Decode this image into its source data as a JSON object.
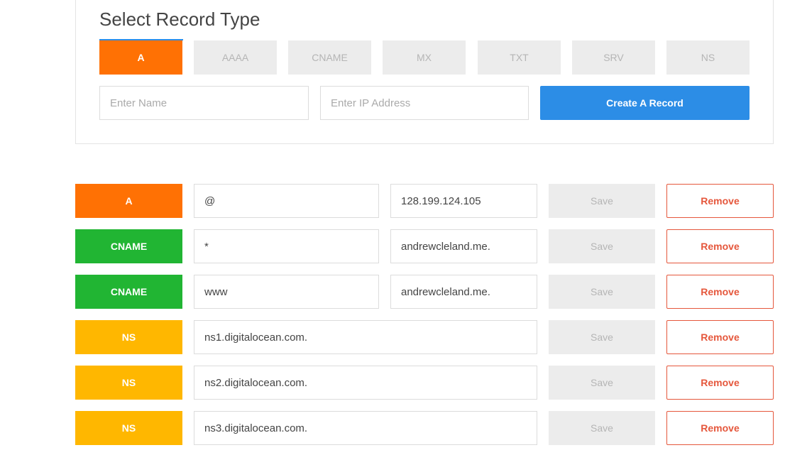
{
  "section": {
    "title": "Select Record Type"
  },
  "type_tabs": [
    {
      "label": "A",
      "active": true
    },
    {
      "label": "AAAA",
      "active": false
    },
    {
      "label": "CNAME",
      "active": false
    },
    {
      "label": "MX",
      "active": false
    },
    {
      "label": "TXT",
      "active": false
    },
    {
      "label": "SRV",
      "active": false
    },
    {
      "label": "NS",
      "active": false
    }
  ],
  "form": {
    "name_placeholder": "Enter Name",
    "name_value": "",
    "ip_placeholder": "Enter IP Address",
    "ip_value": "",
    "create_label": "Create A Record"
  },
  "records": [
    {
      "type": "A",
      "color": "#ff7104",
      "name": "@",
      "value": "128.199.124.105"
    },
    {
      "type": "CNAME",
      "color": "#21b533",
      "name": "*",
      "value": "andrewcleland.me."
    },
    {
      "type": "CNAME",
      "color": "#21b533",
      "name": "www",
      "value": "andrewcleland.me."
    },
    {
      "type": "NS",
      "color": "#ffb700",
      "name": "ns1.digitalocean.com.",
      "value": null
    },
    {
      "type": "NS",
      "color": "#ffb700",
      "name": "ns2.digitalocean.com.",
      "value": null
    },
    {
      "type": "NS",
      "color": "#ffb700",
      "name": "ns3.digitalocean.com.",
      "value": null
    }
  ],
  "labels": {
    "save": "Save",
    "remove": "Remove"
  },
  "colors": {
    "accent_blue": "#2c8de6",
    "type_a": "#ff7104",
    "type_cname": "#21b533",
    "type_ns": "#ffb700",
    "danger": "#e5573c"
  }
}
